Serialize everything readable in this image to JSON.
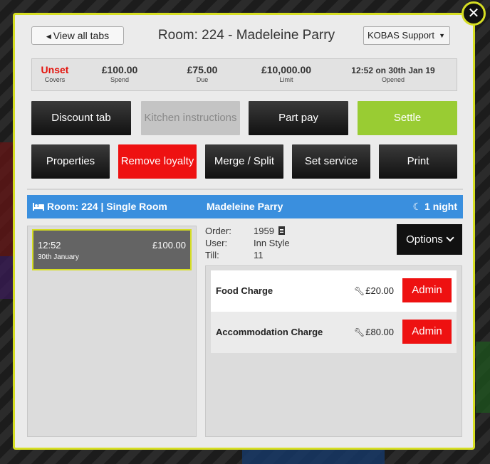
{
  "header": {
    "view_all_label": "View all tabs",
    "title": "Room: 224 - Madeleine Parry",
    "staff_selected": "KOBAS Support"
  },
  "summary": {
    "covers": {
      "value": "Unset",
      "label": "Covers"
    },
    "spend": {
      "value": "£100.00",
      "label": "Spend"
    },
    "due": {
      "value": "£75.00",
      "label": "Due"
    },
    "limit": {
      "value": "£10,000.00",
      "label": "Limit"
    },
    "opened": {
      "value": "12:52 on 30th Jan 19",
      "label": "Opened"
    }
  },
  "actions_row1": {
    "discount": "Discount tab",
    "kitchen": "Kitchen instructions",
    "part_pay": "Part pay",
    "settle": "Settle"
  },
  "actions_row2": {
    "properties": "Properties",
    "remove_loyalty": "Remove loyalty",
    "merge_split": "Merge / Split",
    "set_service": "Set service",
    "print": "Print"
  },
  "room_bar": {
    "room": "Room: 224 | Single Room",
    "guest": "Madeleine Parry",
    "nights": "1 night"
  },
  "tab_card": {
    "time": "12:52",
    "date": "30th January",
    "amount": "£100.00"
  },
  "order": {
    "order_label": "Order:",
    "order_value": "1959",
    "user_label": "User:",
    "user_value": "Inn Style",
    "till_label": "Till:",
    "till_value": "11"
  },
  "options_label": "Options",
  "charges": [
    {
      "name": "Food Charge",
      "amount": "£20.00",
      "action": "Admin"
    },
    {
      "name": "Accommodation Charge",
      "amount": "£80.00",
      "action": "Admin"
    }
  ],
  "colors": {
    "accent_yellow": "#d6de23",
    "room_bar_blue": "#3a8fde",
    "settle_green": "#99cc33",
    "danger_red": "#ee1111",
    "unset_red": "#e3120b"
  },
  "icons": {
    "close": "close-icon",
    "caret": "caret-left-icon",
    "bed": "bed-icon",
    "moon": "moon-icon",
    "document": "document-icon",
    "chevron": "chevron-down-icon",
    "wrench": "wrench-icon"
  }
}
